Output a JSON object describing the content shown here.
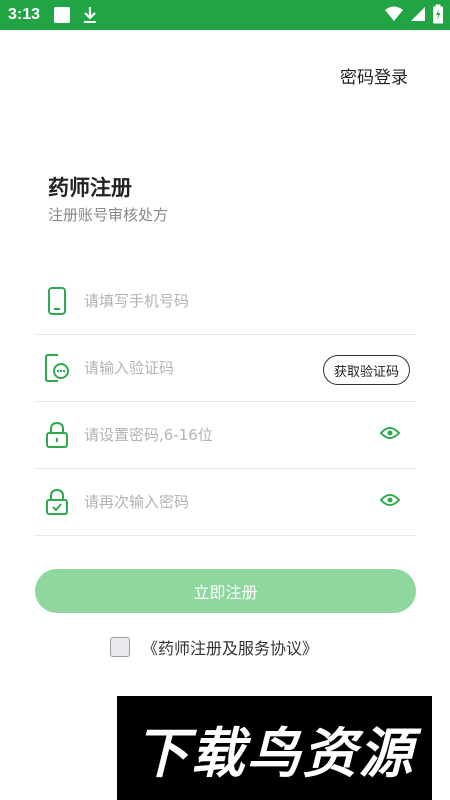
{
  "status_bar": {
    "time": "3:13"
  },
  "header": {
    "password_login": "密码登录"
  },
  "page": {
    "title": "药师注册",
    "subtitle": "注册账号审核处方"
  },
  "form": {
    "phone_placeholder": "请填写手机号码",
    "code_placeholder": "请输入验证码",
    "get_code_button": "获取验证码",
    "password_placeholder": "请设置密码,6-16位",
    "confirm_placeholder": "请再次输入密码"
  },
  "actions": {
    "register_button": "立即注册"
  },
  "agreement": {
    "text": "《药师注册及服务协议》",
    "checked": false
  },
  "watermark": {
    "text": "下载鸟资源"
  },
  "colors": {
    "accent": "#21a544",
    "button_disabled": "#8fd69f",
    "icon": "#2daa4f"
  }
}
